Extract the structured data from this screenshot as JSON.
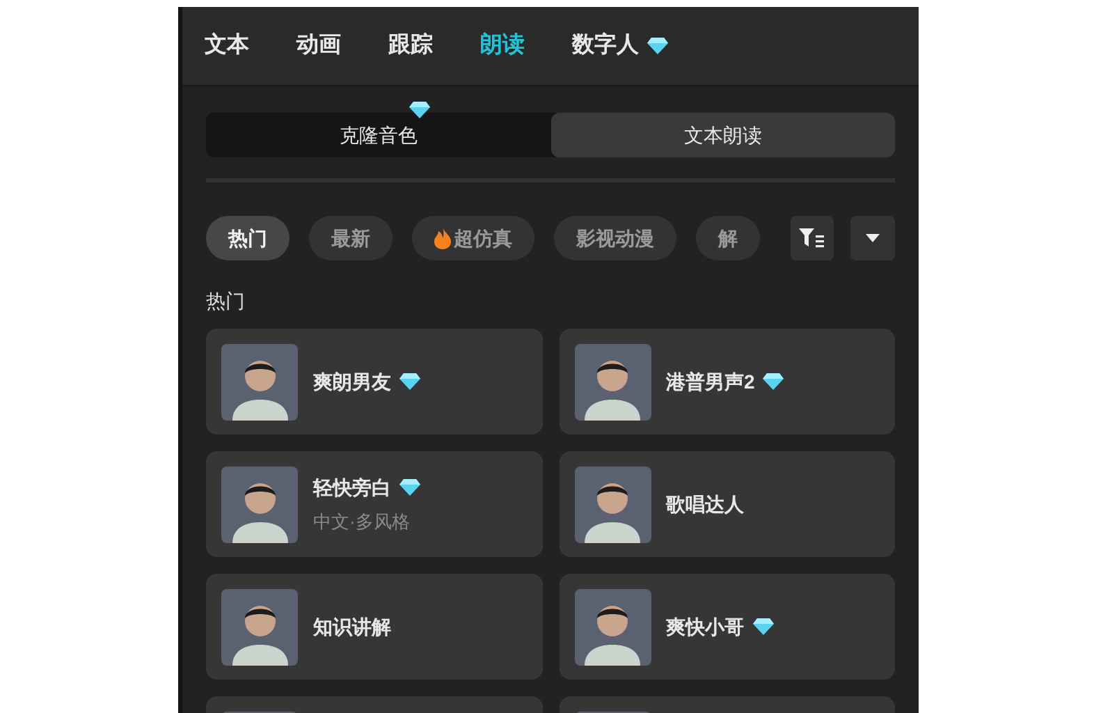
{
  "tabs": [
    {
      "label": "文本",
      "selected": false,
      "premium": false
    },
    {
      "label": "动画",
      "selected": false,
      "premium": false
    },
    {
      "label": "跟踪",
      "selected": false,
      "premium": false
    },
    {
      "label": "朗读",
      "selected": true,
      "premium": false
    },
    {
      "label": "数字人",
      "selected": false,
      "premium": true
    }
  ],
  "modes": [
    {
      "label": "克隆音色",
      "selected": false,
      "premium": true
    },
    {
      "label": "文本朗读",
      "selected": true,
      "premium": false
    }
  ],
  "categories": [
    {
      "label": "热门",
      "selected": true,
      "hot": false
    },
    {
      "label": "最新",
      "selected": false,
      "hot": false
    },
    {
      "label": "超仿真",
      "selected": false,
      "hot": true
    },
    {
      "label": "影视动漫",
      "selected": false,
      "hot": false
    },
    {
      "label": "解",
      "selected": false,
      "hot": false
    }
  ],
  "section_title": "热门",
  "voices": [
    {
      "kind": "voice",
      "name": "爽朗男友",
      "premium": true
    },
    {
      "kind": "voice",
      "name": "港普男声2",
      "premium": true
    },
    {
      "kind": "voice",
      "name": "轻快旁白",
      "premium": true,
      "subtitle": "中文·多风格"
    },
    {
      "kind": "voice",
      "name": "歌唱达人",
      "premium": false
    },
    {
      "kind": "voice",
      "name": "知识讲解",
      "premium": false
    },
    {
      "kind": "voice",
      "name": "爽快小哥",
      "premium": true
    },
    {
      "kind": "partial"
    },
    {
      "kind": "partial"
    }
  ]
}
